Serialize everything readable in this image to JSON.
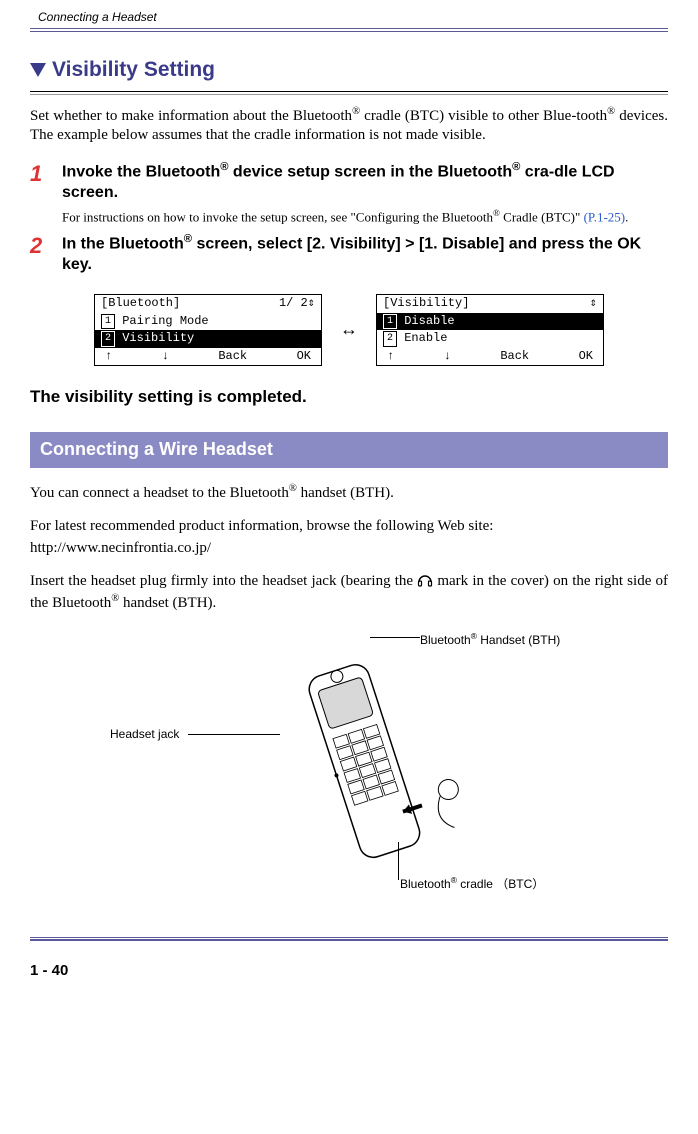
{
  "runningHead": "Connecting a Headset",
  "sectionTitle": "Visibility Setting",
  "introPrefix": "Set whether to make information about the Bluetooth",
  "introMid": " cradle (BTC) visible to other Blue-tooth",
  "introSuffix": " devices. The example below assumes that the cradle information is not made visible.",
  "steps": [
    {
      "num": "1",
      "titlePrefix": "Invoke the Bluetooth",
      "titleMid": " device setup screen in the Bluetooth",
      "titleSuffix": " cra-dle LCD screen.",
      "notePrefix": "For instructions on how to invoke the setup screen, see \"Configuring the Bluetooth",
      "noteMid": " Cradle (BTC)\"  ",
      "noteLink": "(P.1-25)",
      "noteSuffix": "."
    },
    {
      "num": "2",
      "titlePrefix": "In the Bluetooth",
      "titleSuffix": " screen, select [2. Visibility] > [1. Disable] and press the OK key."
    }
  ],
  "lcd1": {
    "title": "[Bluetooth]",
    "right": "1/ 2",
    "line1_icon": "1",
    "line1_text": " Pairing Mode",
    "line2_icon": "2",
    "line2_text": " Visibility",
    "soft": [
      "↑",
      "↓",
      "Back",
      "OK"
    ]
  },
  "lcd2": {
    "title": "[Visibility]",
    "line1_icon": "1",
    "line1_text": " Disable",
    "line2_icon": "2",
    "line2_text": " Enable",
    "soft": [
      "↑",
      "↓",
      "Back",
      "OK"
    ]
  },
  "completedText": "The visibility setting is completed.",
  "blueBar": "Connecting a Wire Headset",
  "para1Prefix": "You can connect a headset to the Bluetooth",
  "para1Suffix": " handset (BTH).",
  "para2": "For latest recommended product information, browse the following Web site:",
  "url": "http://www.necinfrontia.co.jp/",
  "para3Prefix": "Insert the headset plug firmly into the headset jack (bearing the ",
  "para3Mid": " mark in the cover) on the right side of the Bluetooth",
  "para3Suffix": " handset (BTH).",
  "labels": {
    "bthPrefix": "Bluetooth",
    "bthSuffix": " Handset (BTH)",
    "headsetJack": "Headset jack",
    "btcPrefix": "Bluetooth",
    "btcSuffix": " cradle （BTC）"
  },
  "pageNum": "1 - 40"
}
